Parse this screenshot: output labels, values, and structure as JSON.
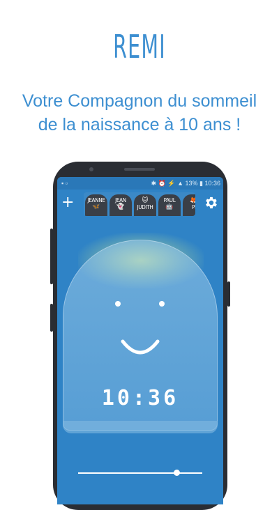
{
  "brand": "REMI",
  "tagline": [
    "Votre Compagnon du sommeil",
    "de la naissance à 10 ans !"
  ],
  "statusbar": {
    "left": "▪ ▫",
    "right": "✱ ⏰ ⚡ ▲ 13% ▮ 10:36"
  },
  "toolbar": {
    "add_label": "+"
  },
  "profiles": [
    {
      "name": "JEANNE",
      "icon": "🦋"
    },
    {
      "name": "JEAN",
      "icon": "👻"
    },
    {
      "name": "JUDITH",
      "icon": "🐱"
    },
    {
      "name": "PAUL",
      "icon": "🤖"
    },
    {
      "name": "PI",
      "icon": "🦊"
    }
  ],
  "clock": "10:36",
  "brightness": 0.79
}
